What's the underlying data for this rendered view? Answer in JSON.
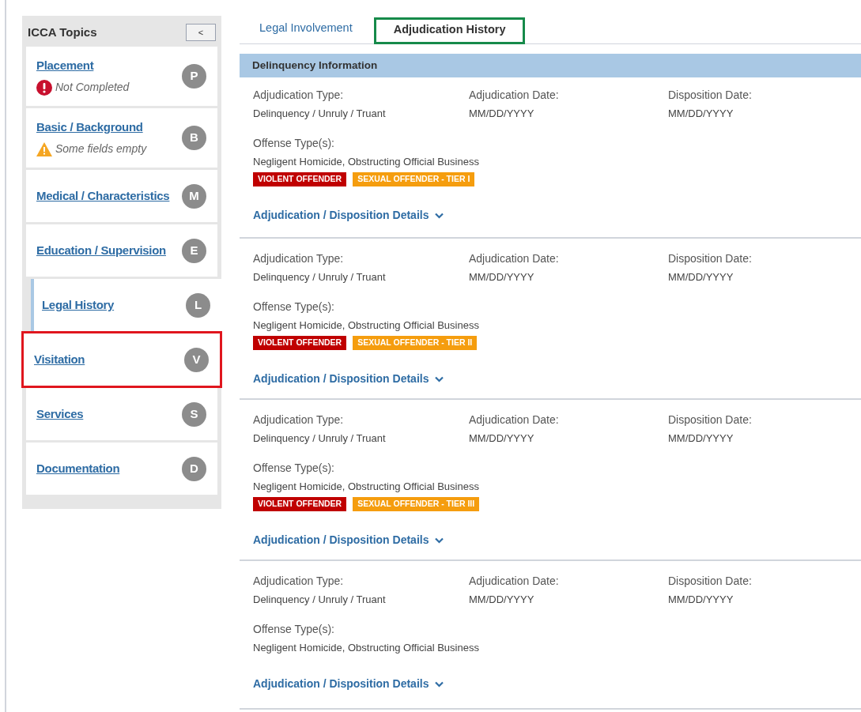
{
  "sidebar": {
    "title": "ICCA Topics",
    "collapse_button": "<",
    "items": [
      {
        "label": "Placement",
        "badge": "P",
        "status": {
          "kind": "error",
          "text": "Not Completed"
        },
        "selected": false,
        "highlighted": false
      },
      {
        "label": "Basic / Background",
        "badge": "B",
        "status": {
          "kind": "warning",
          "text": "Some fields empty"
        },
        "selected": false,
        "highlighted": false
      },
      {
        "label": "Medical / Characteristics",
        "badge": "M",
        "selected": false,
        "highlighted": false
      },
      {
        "label": "Education / Supervision",
        "badge": "E",
        "selected": false,
        "highlighted": false
      },
      {
        "label": "Legal History",
        "badge": "L",
        "selected": true,
        "highlighted": false
      },
      {
        "label": "Visitation",
        "badge": "V",
        "selected": false,
        "highlighted": true
      },
      {
        "label": "Services",
        "badge": "S",
        "selected": false,
        "highlighted": false
      },
      {
        "label": "Documentation",
        "badge": "D",
        "selected": false,
        "highlighted": false
      }
    ]
  },
  "tabs": [
    {
      "label": "Legal Involvement",
      "selected": false,
      "highlighted": false
    },
    {
      "label": "Adjudication History",
      "selected": true,
      "highlighted": true
    }
  ],
  "section": {
    "title": "Delinquency Information",
    "records": [
      {
        "fields": [
          {
            "label": "Adjudication Type:",
            "value": "Delinquency / Unruly / Truant"
          },
          {
            "label": "Adjudication Date:",
            "value": "MM/DD/YYYY"
          },
          {
            "label": "Disposition Date:",
            "value": "MM/DD/YYYY"
          }
        ],
        "offense_label": "Offense Type(s):",
        "offenses": "Negligent Homicide, Obstructing Official Business",
        "tags": [
          {
            "text": "VIOLENT OFFENDER",
            "color": "#c00000"
          },
          {
            "text": "SEXUAL OFFENDER - TIER I",
            "color": "#f59d0e"
          }
        ],
        "details_link": "Adjudication / Disposition Details"
      },
      {
        "fields": [
          {
            "label": "Adjudication Type:",
            "value": "Delinquency / Unruly / Truant"
          },
          {
            "label": "Adjudication Date:",
            "value": "MM/DD/YYYY"
          },
          {
            "label": "Disposition Date:",
            "value": "MM/DD/YYYY"
          }
        ],
        "offense_label": "Offense Type(s):",
        "offenses": "Negligent Homicide, Obstructing Official Business",
        "tags": [
          {
            "text": "VIOLENT OFFENDER",
            "color": "#c00000"
          },
          {
            "text": "SEXUAL OFFENDER - TIER II",
            "color": "#f59d0e"
          }
        ],
        "details_link": "Adjudication / Disposition Details"
      },
      {
        "fields": [
          {
            "label": "Adjudication Type:",
            "value": "Delinquency / Unruly / Truant"
          },
          {
            "label": "Adjudication Date:",
            "value": "MM/DD/YYYY"
          },
          {
            "label": "Disposition Date:",
            "value": "MM/DD/YYYY"
          }
        ],
        "offense_label": "Offense Type(s):",
        "offenses": "Negligent Homicide, Obstructing Official Business",
        "tags": [
          {
            "text": "VIOLENT OFFENDER",
            "color": "#c00000"
          },
          {
            "text": "SEXUAL OFFENDER - TIER III",
            "color": "#f59d0e"
          }
        ],
        "details_link": "Adjudication / Disposition Details"
      },
      {
        "fields": [
          {
            "label": "Adjudication Type:",
            "value": "Delinquency / Unruly / Truant"
          },
          {
            "label": "Adjudication Date:",
            "value": "MM/DD/YYYY"
          },
          {
            "label": "Disposition Date:",
            "value": "MM/DD/YYYY"
          }
        ],
        "offense_label": "Offense Type(s):",
        "offenses": "Negligent Homicide, Obstructing Official Business",
        "details_link": "Adjudication / Disposition Details"
      }
    ]
  }
}
